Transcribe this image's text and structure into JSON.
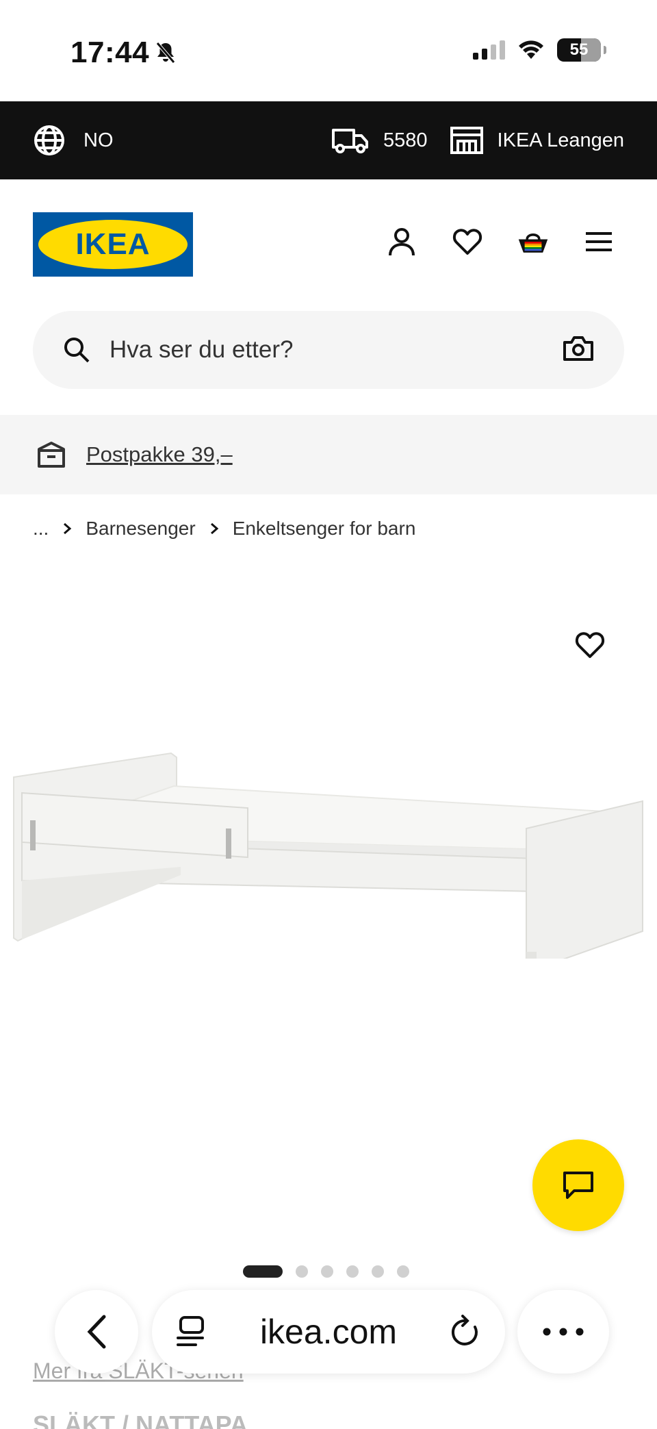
{
  "status_bar": {
    "time": "17:44",
    "battery": "55"
  },
  "topbar": {
    "language": "NO",
    "postcode": "5580",
    "store": "IKEA Leangen"
  },
  "header": {
    "logo_text": "IKEA"
  },
  "search": {
    "placeholder": "Hva ser du etter?"
  },
  "promo": {
    "text": "Postpakke 39,–"
  },
  "breadcrumb": {
    "ellipsis": "...",
    "items": [
      "Barnesenger",
      "Enkeltsenger for barn"
    ]
  },
  "carousel": {
    "total": 6,
    "active": 1
  },
  "below": {
    "series_link": "Mer fra SLÄKT-serien",
    "product_title": "SLÄKT / NATTAPA"
  },
  "browser": {
    "url": "ikea.com"
  },
  "colors": {
    "ikea_blue": "#0058a3",
    "ikea_yellow": "#ffdb00",
    "topbar_bg": "#111111"
  }
}
